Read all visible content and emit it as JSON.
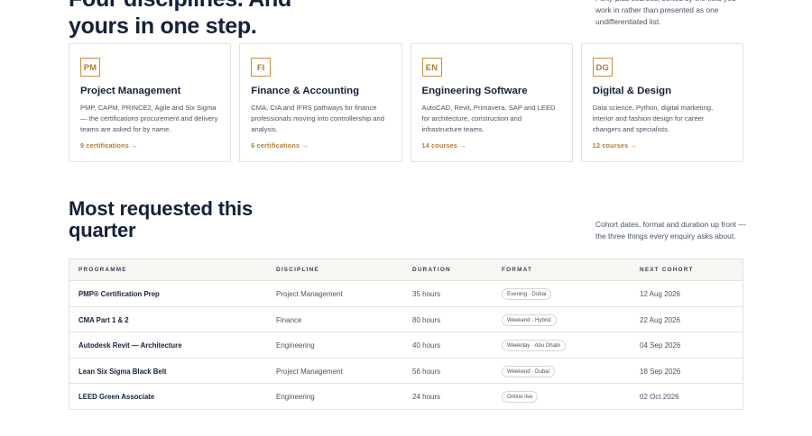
{
  "hero": {
    "title_line1": "Four disciplines. And",
    "title_line2": "yours in one step.",
    "note": "Forty-plus courses, sorted by the field you work in rather than presented as one undifferentiated list."
  },
  "cards": [
    {
      "code": "PM",
      "title": "Project Management",
      "desc": "PMP, CAPM, PRINCE2, Agile and Six Sigma — the certifications procurement and delivery teams are asked for by name.",
      "link": "9 certifications →"
    },
    {
      "code": "FI",
      "title": "Finance & Accounting",
      "desc": "CMA, CIA and IFRS pathways for finance professionals moving into controllership and analysis.",
      "link": "6 certifications →"
    },
    {
      "code": "EN",
      "title": "Engineering Software",
      "desc": "AutoCAD, Revit, Primavera, SAP and LEED for architecture, construction and infrastructure teams.",
      "link": "14 courses →"
    },
    {
      "code": "DG",
      "title": "Digital & Design",
      "desc": "Data science, Python, digital marketing, interior and fashion design for career changers and specialists.",
      "link": "12 courses →"
    }
  ],
  "section": {
    "title_line1": "Most requested this",
    "title_line2": "quarter",
    "note": "Cohort dates, format and duration up front — the three things every enquiry asks about."
  },
  "table": {
    "headers": [
      "PROGRAMME",
      "DISCIPLINE",
      "DURATION",
      "FORMAT",
      "NEXT COHORT"
    ],
    "rows": [
      {
        "programme": "PMP® Certification Prep",
        "discipline": "Project Management",
        "duration": "35 hours",
        "format": "Evening · Dubai",
        "cohort": "12 Aug 2026"
      },
      {
        "programme": "CMA Part 1 & 2",
        "discipline": "Finance",
        "duration": "80 hours",
        "format": "Weekend · Hybrid",
        "cohort": "22 Aug 2026"
      },
      {
        "programme": "Autodesk Revit — Architecture",
        "discipline": "Engineering",
        "duration": "40 hours",
        "format": "Weekday · Abu Dhabi",
        "cohort": "04 Sep 2026"
      },
      {
        "programme": "Lean Six Sigma Black Belt",
        "discipline": "Project Management",
        "duration": "56 hours",
        "format": "Weekend · Dubai",
        "cohort": "18 Sep 2026"
      },
      {
        "programme": "LEED Green Associate",
        "discipline": "Engineering",
        "duration": "24 hours",
        "format": "Online live",
        "cohort": "02 Oct 2026"
      }
    ]
  },
  "colors": {
    "accent": "#b47a2c",
    "heading": "#14213a",
    "border": "#e3e1dc"
  }
}
